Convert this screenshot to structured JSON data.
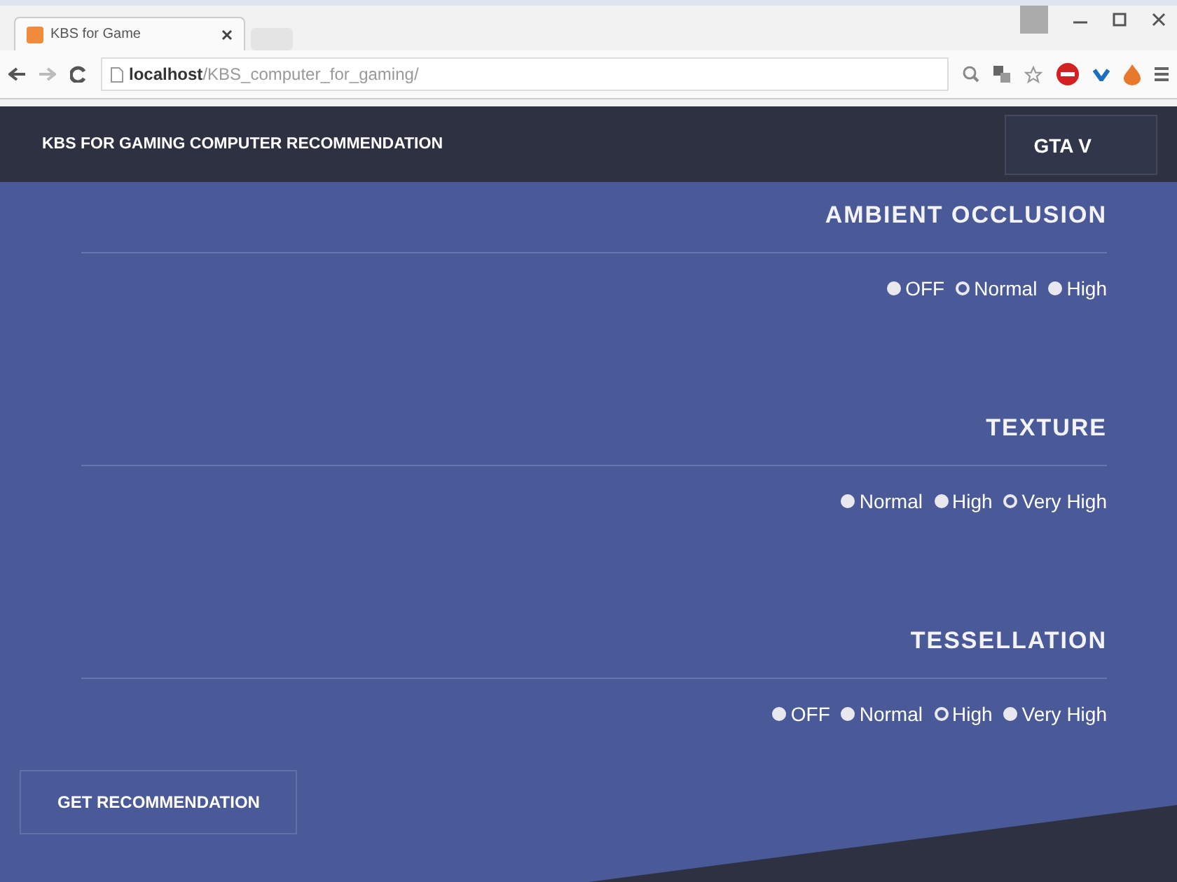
{
  "browser": {
    "tab_title": "KBS for Game",
    "url_host": "localhost",
    "url_path": "/KBS_computer_for_gaming/"
  },
  "header": {
    "title": "KBS FOR GAMING COMPUTER RECOMMENDATION",
    "game": "GTA V"
  },
  "sections": [
    {
      "title": "AMBIENT OCCLUSION",
      "options": [
        {
          "label": "OFF",
          "selected": false
        },
        {
          "label": "Normal",
          "selected": true
        },
        {
          "label": "High",
          "selected": false
        }
      ]
    },
    {
      "title": "TEXTURE",
      "options": [
        {
          "label": "Normal",
          "selected": false
        },
        {
          "label": "High",
          "selected": false
        },
        {
          "label": "Very High",
          "selected": true
        }
      ]
    },
    {
      "title": "TESSELLATION",
      "options": [
        {
          "label": "OFF",
          "selected": false
        },
        {
          "label": "Normal",
          "selected": false
        },
        {
          "label": "High",
          "selected": true
        },
        {
          "label": "Very High",
          "selected": false
        }
      ]
    }
  ],
  "button": "GET RECOMMENDATION"
}
